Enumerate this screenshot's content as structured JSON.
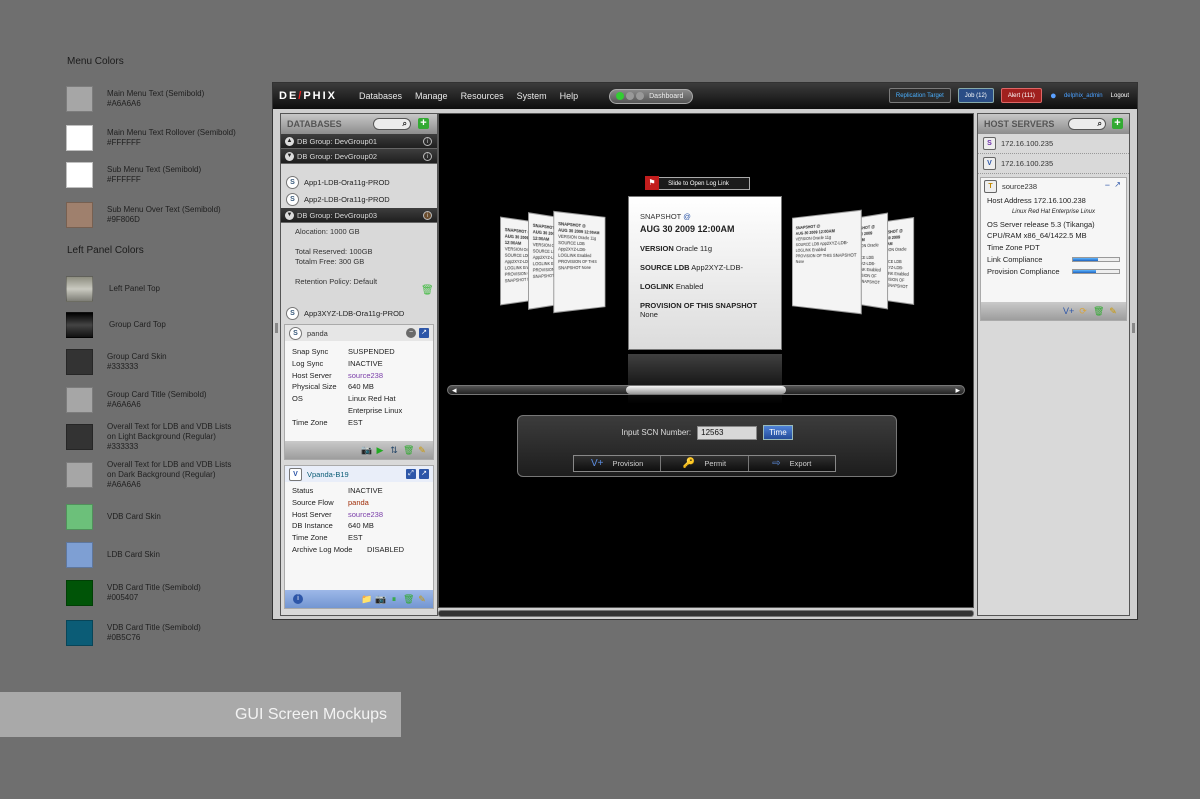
{
  "legend": {
    "menu_colors_title": "Menu Colors",
    "left_panel_colors_title": "Left Panel Colors",
    "menu_swatches": [
      {
        "color": "#A6A6A6",
        "label": "Main Menu Text (Semibold)",
        "code": "#A6A6A6"
      },
      {
        "color": "#FFFFFF",
        "label": "Main Menu Text Rollover  (Semibold)",
        "code": "#FFFFFF"
      },
      {
        "color": "#FFFFFF",
        "label": "Sub Menu Text (Semibold)",
        "code": "#FFFFFF"
      },
      {
        "color": "#9F806D",
        "label": "Sub Menu Over Text (Semibold)",
        "code": "#9F806D"
      }
    ],
    "panel_swatches": [
      {
        "label": "Left Panel Top",
        "code": ""
      },
      {
        "label": "Group Card Top",
        "code": ""
      },
      {
        "color": "#333333",
        "label": "Group Card Skin",
        "code": "#333333"
      },
      {
        "color": "#A6A6A6",
        "label": "Group Card Title (Semibold)",
        "code": "#A6A6A6"
      },
      {
        "color": "#333333",
        "label": "Overall Text for LDB and VDB Lists on Light Background (Regular)",
        "code": "#333333"
      },
      {
        "color": "#A6A6A6",
        "label": "Overall Text for LDB and VDB Lists on Dark Background (Regular)",
        "code": "#A6A6A6"
      },
      {
        "color": "#6CC07A",
        "label": "VDB Card Skin",
        "code": ""
      },
      {
        "color": "#7E9FD3",
        "label": "LDB Card Skin",
        "code": ""
      },
      {
        "color": "#005407",
        "label": "VDB Card Title (Semibold)",
        "code": "#005407"
      },
      {
        "color": "#0B5C76",
        "label": "VDB Card Title (Semibold)",
        "code": "#0B5C76"
      }
    ]
  },
  "caption": "GUI Screen Mockups",
  "app": {
    "logo_left": "DE",
    "logo_slash": "/",
    "logo_right": "PHIX",
    "menu": [
      "Databases",
      "Manage",
      "Resources",
      "System",
      "Help"
    ],
    "dashboard_label": "Dashboard",
    "replication_target": "Replication Target",
    "job_label": "Job (12)",
    "alert_label": "Alert (111)",
    "user": "delphix_admin",
    "logout": "Logout"
  },
  "left": {
    "title": "DATABASES",
    "groups": [
      "DB Group: DevGroup01",
      "DB Group: DevGroup02",
      "DB Group: DevGroup03"
    ],
    "group2_items": [
      "App1-LDB-Ora11g-PROD",
      "App2-LDB-Ora11g-PROD"
    ],
    "group3_details": {
      "allocation": "Alocation: 1000 GB",
      "total_reserved": "Total Reserved: 100GB",
      "total_free": "Totalm Free: 300 GB",
      "retention": "Retention Policy: Default"
    },
    "group3_item": "App3XYZ-LDB-Ora11g-PROD",
    "ldb_card": {
      "name": "panda",
      "fields": [
        {
          "k": "Snap Sync",
          "v": "SUSPENDED"
        },
        {
          "k": "Log Sync",
          "v": "INACTIVE"
        },
        {
          "k": "Host Server",
          "v": "source238"
        },
        {
          "k": "Physical Size",
          "v": "640 MB"
        },
        {
          "k": "OS",
          "v": "Linux Red Hat"
        },
        {
          "k": "",
          "v": "Enterprise Linux"
        },
        {
          "k": "Time Zone",
          "v": "EST"
        }
      ]
    },
    "vdb_card": {
      "name": "Vpanda-B19",
      "fields": [
        {
          "k": "Status",
          "v": "INACTIVE"
        },
        {
          "k": "Source Flow",
          "v": "panda"
        },
        {
          "k": "Host Server",
          "v": "source238"
        },
        {
          "k": "DB Instance",
          "v": "640 MB"
        },
        {
          "k": "Time Zone",
          "v": "EST"
        },
        {
          "k": "Archive Log Mode",
          "v": "DISABLED"
        }
      ]
    }
  },
  "viewer": {
    "slide_tag": "Slide to Open Log Link",
    "snapshot_label": "SNAPSHOT",
    "snapshot_at": "@",
    "date": "AUG 30 2009 12:00AM",
    "version_k": "VERSION",
    "version_v": "Oracle 11g",
    "source_k": "SOURCE LDB",
    "source_v": "App2XYZ-LDB-",
    "loglink_k": "LOGLINK",
    "loglink_v": "Enabled",
    "provision_k": "PROVISION OF THIS SNAPSHOT",
    "provision_v": "None",
    "mini_lines": [
      "SNAPSHOT @",
      "AUG 30 2009 12:00AM",
      "VERSION Oracle 11g",
      "SOURCE LDB App2XYZ-LDB-",
      "LOGLINK Enabled",
      "PROVISION OF THIS SNAPSHOT None"
    ],
    "scn_label": "Input SCN Number:",
    "scn_value": "12563",
    "time_button": "Time",
    "actions": [
      "Provision",
      "Permit",
      "Export"
    ]
  },
  "right": {
    "title": "HOST SERVERS",
    "hosts": [
      "172.16.100.235",
      "172.16.100.235"
    ],
    "host_card": {
      "name": "source238",
      "address": "Host Address 172.16.100.238",
      "os_desc": "Linux Red Hat Enterprise Linux",
      "release": "OS Server release 5.3 (Tikanga)",
      "cpu": "CPU/RAM x86_64/1422.5 MB",
      "tz": "Time Zone PDT",
      "link_compliance_label": "Link Compliance",
      "link_compliance_level": 0.55,
      "provision_compliance_label": "Provision Compliance",
      "provision_compliance_level": 0.5
    }
  }
}
